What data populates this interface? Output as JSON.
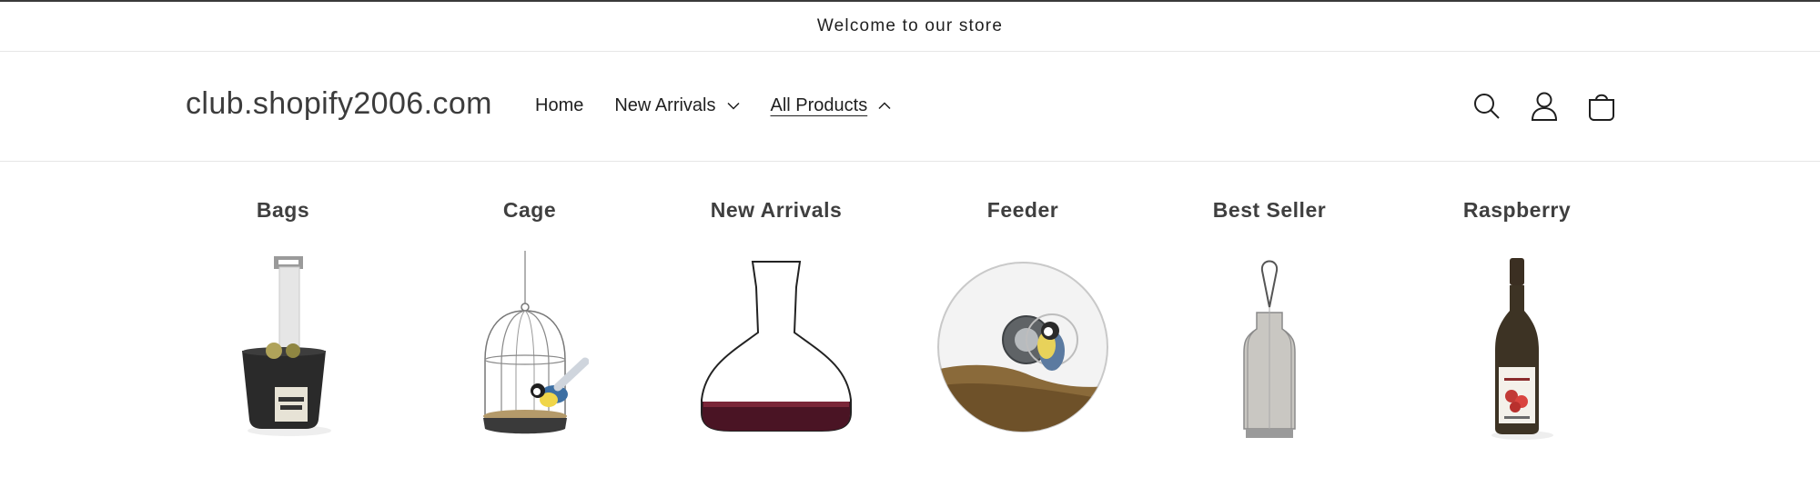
{
  "announcement": {
    "text": "Welcome to our store"
  },
  "header": {
    "logo": "club.shopify2006.com",
    "nav": [
      {
        "label": "Home"
      },
      {
        "label": "New Arrivals"
      },
      {
        "label": "All Products"
      }
    ]
  },
  "menu": {
    "columns": [
      {
        "title": "Bags",
        "image": "wall-mounted bag holder"
      },
      {
        "title": "Cage",
        "image": "bird cage with bird"
      },
      {
        "title": "New Arrivals",
        "image": "wine decanter"
      },
      {
        "title": "Feeder",
        "image": "window bird feeder"
      },
      {
        "title": "Best Seller",
        "image": "hanging lantern"
      },
      {
        "title": "Raspberry",
        "image": "raspberry bottle"
      }
    ]
  },
  "colors": {
    "text": "#121212",
    "border": "#e6e6e6",
    "heading": "#3f3f3f"
  }
}
